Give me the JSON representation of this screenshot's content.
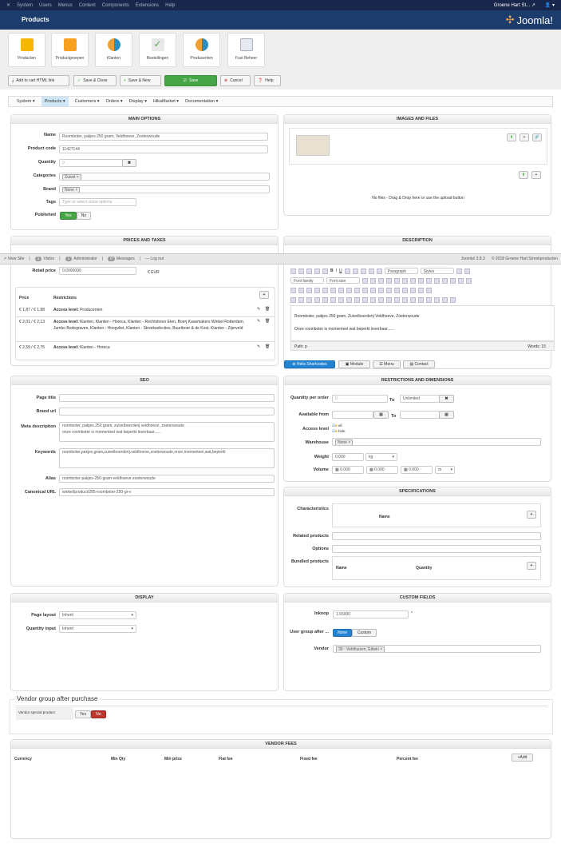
{
  "topnav": {
    "items": [
      "System",
      "Users",
      "Menus",
      "Content",
      "Components",
      "Extensions",
      "Help"
    ],
    "site": "Groene Hart St... ↗",
    "user": "👤 ▾"
  },
  "header": {
    "title": "Products",
    "logo": "Joomla!"
  },
  "quickicons": [
    "Producten",
    "Productgroepen",
    "Klanten",
    "Bestellingen",
    "Producenten",
    "Fust Beheer"
  ],
  "toolbar": {
    "cart_link": "Add to cart HTML link",
    "save_close": "Save & Close",
    "save_new": "Save & New",
    "save": "Save",
    "cancel": "Cancel",
    "help": "Help"
  },
  "hikamenu": [
    "System ▾",
    "Products ▾",
    "Customers ▾",
    "Orders ▾",
    "Display ▾",
    "HikaMarket ▾",
    "Documentation ▾"
  ],
  "main_options": {
    "title": "MAIN OPTIONS",
    "name_label": "Name",
    "name": "Roomboter, pakjes 250 gram, Veldhoeve, Zoeterwoude",
    "code_label": "Product code",
    "code": "11427144",
    "qty_label": "Quantity",
    "qty": "0",
    "cat_label": "Categories",
    "cat": "Zuivel ×",
    "brand_label": "Brand",
    "brand": "None ×",
    "tags_label": "Tags",
    "tags_ph": "Type or select some options",
    "pub_label": "Published",
    "yes": "Yes",
    "no": "No"
  },
  "images": {
    "title": "IMAGES AND FILES",
    "nofiles": "No files - Drag & Drop here or use the upload button"
  },
  "prices": {
    "title": "PRICES AND TAXES",
    "retail_label": "Retail price",
    "retail": "0.0000000",
    "currency": "€ EUR",
    "col_price": "Price",
    "col_restr": "Restrictions",
    "rows": [
      {
        "price": "€ 1,87 / € 1,98",
        "label": "Access level:",
        "restr": "Producenten"
      },
      {
        "price": "€ 2,01 / € 2,13",
        "label": "Access level:",
        "restr": "Klanten, Klanten - Horeca, Klanten - Rechtstreex Eten, Boerj Kaasmakers Winkel Rotterdam, Jumbo Bodegraven, Klanten - Hoogvliet, Klanten - Streekselecties, Buurtboer & de Kost, Klanten - Zijerveld"
      },
      {
        "price": "€ 2,59 / € 2,75",
        "label": "Access level:",
        "restr": "Klanten - Horeca"
      }
    ]
  },
  "status": {
    "view_site": "View Site",
    "visitors": "1",
    "visitor_label": "Visitor",
    "admins": "1",
    "admin_label": "Administrator",
    "messages": "0",
    "messages_label": "Messages",
    "logout": "Log out",
    "version": "Joomla! 3.8.3",
    "copyright": "© 2018 Groene Hart Streekproducten"
  },
  "description": {
    "title": "DESCRIPTION",
    "format": "Paragraph",
    "styles": "Styles",
    "fontfamily": "Font family",
    "fontsize": "Font size",
    "line1": "Roomboter, pakjes 250 gram, Zuivelboerderij Veldhoeve, Zoeterwoude",
    "line2": "Onze roomboter is momenteel wat beperkt leverbaar......",
    "path": "Path: p",
    "words": "Words: 15",
    "tabs": [
      "Helix Shortcodes",
      "Module",
      "Menu",
      "Contact"
    ]
  },
  "seo": {
    "title": "SEO",
    "page_title": "Page title",
    "brand_url": "Brand url",
    "meta_label": "Meta description",
    "meta1": "roomboter, pakjes 250 gram, zuivelboerderij veldhoeve, zoeterwoude",
    "meta2": "onze roomboter is momenteel wat beperkt leverbaar......",
    "kw_label": "Keywords",
    "kw": "roomboter,pakjes,gram,zuivelboerderij,veldhoeve,zoeterwoude,onze,momenteel,wat,beperkt",
    "alias_label": "Alias",
    "alias": "roomboter-pakjes-250-gram-veldhoeve-zoeterwoude",
    "canon_label": "Canonical URL",
    "canon": "winkel/product/285-roomboter-250-gr-v"
  },
  "restrictions": {
    "title": "RESTRICTIONS AND DIMENSIONS",
    "qpo": "Quantity per order",
    "qpo_val": "0",
    "to": "To",
    "unlimited": "Unlimited",
    "avail": "Available from",
    "access": "Access level",
    "all": "all",
    "hide": "hide",
    "warehouse": "Warehouse",
    "wh_val": "None ×",
    "weight": "Weight",
    "weight_val": "0.000",
    "kg": "kg",
    "volume": "Volume",
    "v1": "0.000",
    "v2": "0.000",
    "v3": "0.000",
    "m": "m"
  },
  "specs": {
    "title": "SPECIFICATIONS",
    "characteristics": "Characteristics",
    "name": "Name",
    "related": "Related products",
    "options": "Options",
    "bundled": "Bundled products",
    "quantity": "Quantity"
  },
  "display": {
    "title": "DISPLAY",
    "layout_label": "Page layout",
    "layout": "Inherit",
    "qi_label": "Quantity input",
    "qi": "Inherit"
  },
  "custom": {
    "title": "CUSTOM FIELDS",
    "inkoop_label": "Inkoop",
    "inkoop": "1.65000",
    "ug_label": "User group after ...",
    "none": "None",
    "custom": "Custom",
    "vendor_label": "Vendor",
    "vendor": "30 - Veldhuizen, Edwin ×"
  },
  "vendor_group": {
    "legend": "Vendor group after purchase",
    "label": "Vendor special product",
    "yes": "Yes",
    "no": "No"
  },
  "vendor_fees": {
    "title": "VENDOR FEES",
    "cols": [
      "Currency",
      "Min Qty",
      "Min price",
      "Flat fee",
      "Fixed fee",
      "Percent fee"
    ],
    "add": "+Add"
  }
}
